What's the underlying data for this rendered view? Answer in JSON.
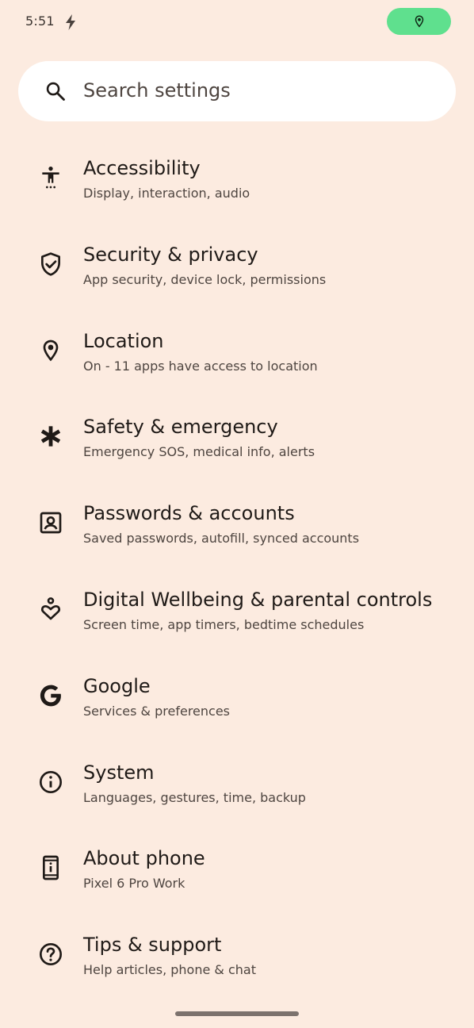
{
  "status_bar": {
    "time": "5:51",
    "icons": [
      "bolt-icon",
      "location-pin-icon"
    ],
    "location_pill_color": "#5fe08e"
  },
  "search": {
    "placeholder": "Search settings"
  },
  "settings": [
    {
      "icon": "accessibility-icon",
      "title": "Accessibility",
      "subtitle": "Display, interaction, audio"
    },
    {
      "icon": "shield-check-icon",
      "title": "Security & privacy",
      "subtitle": "App security, device lock, permissions"
    },
    {
      "icon": "location-pin-icon",
      "title": "Location",
      "subtitle": "On - 11 apps have access to location"
    },
    {
      "icon": "asterisk-icon",
      "title": "Safety & emergency",
      "subtitle": "Emergency SOS, medical info, alerts"
    },
    {
      "icon": "account-box-icon",
      "title": "Passwords & accounts",
      "subtitle": "Saved passwords, autofill, synced accounts"
    },
    {
      "icon": "wellbeing-heart-icon",
      "title": "Digital Wellbeing & parental controls",
      "subtitle": "Screen time, app timers, bedtime schedules"
    },
    {
      "icon": "google-g-icon",
      "title": "Google",
      "subtitle": "Services & preferences"
    },
    {
      "icon": "info-icon",
      "title": "System",
      "subtitle": "Languages, gestures, time, backup"
    },
    {
      "icon": "phone-info-icon",
      "title": "About phone",
      "subtitle": "Pixel 6 Pro Work"
    },
    {
      "icon": "help-circle-icon",
      "title": "Tips & support",
      "subtitle": "Help articles, phone & chat"
    }
  ],
  "colors": {
    "background": "#fcebe0",
    "text_primary": "#1f1a17",
    "text_secondary": "#4e4540"
  }
}
